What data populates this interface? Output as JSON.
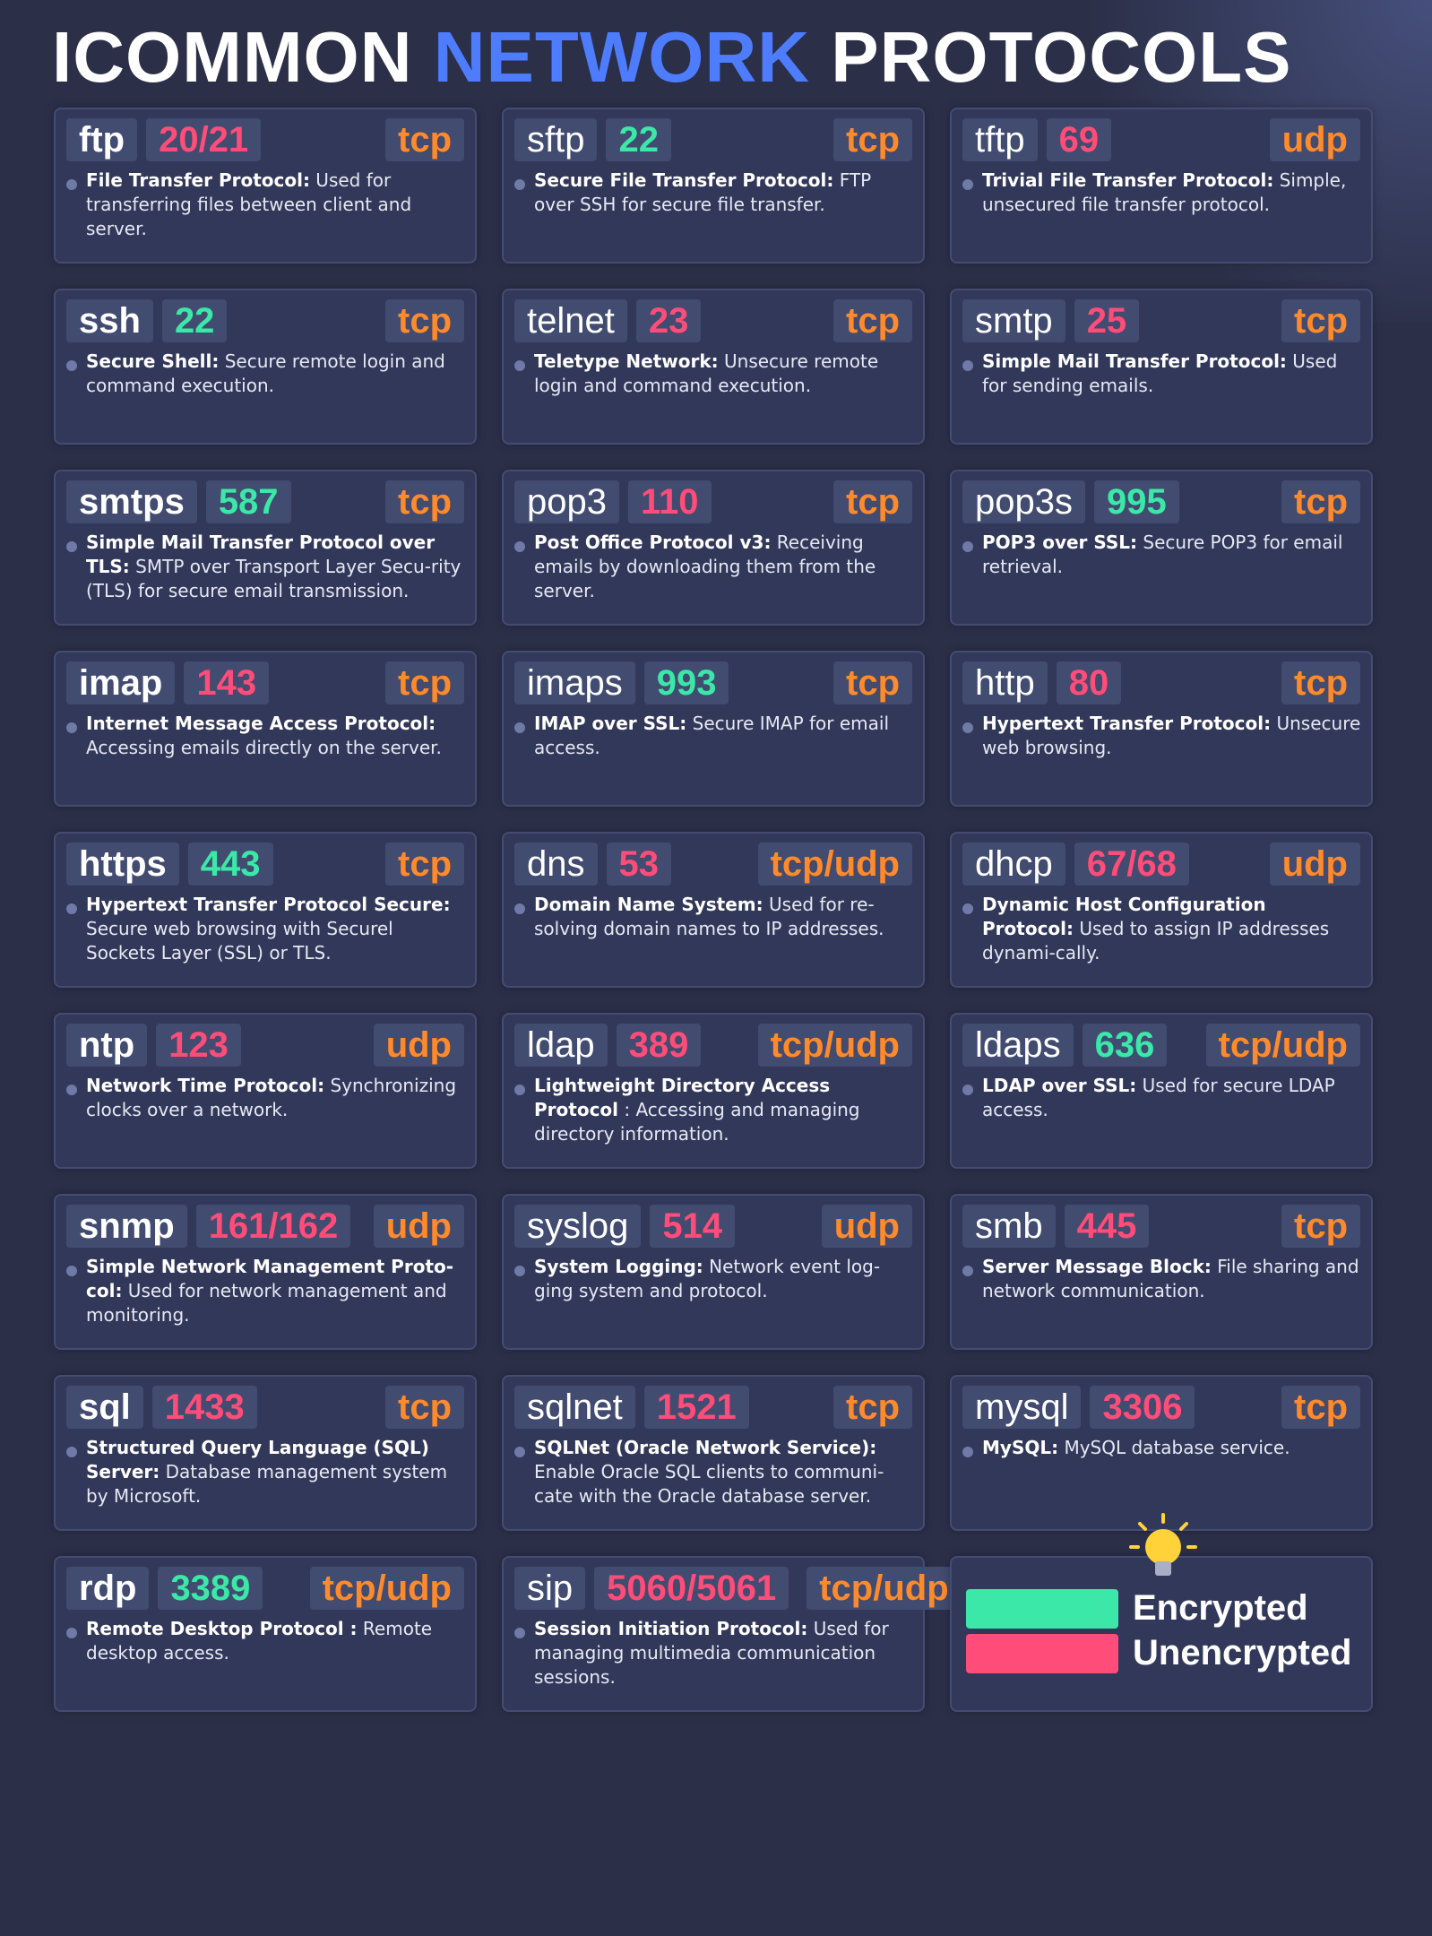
{
  "title": {
    "prefix": "ICOMMON ",
    "accent": "NETWORK",
    "suffix": " PROTOCOLS"
  },
  "colors": {
    "encrypted": "#3be8a8",
    "unencrypted": "#ff4c78",
    "transport": "#ff8a2b",
    "accent": "#4e7cff"
  },
  "protocols": [
    {
      "name": "ftp",
      "port": "20/21",
      "transport": "tcp",
      "encrypted": false,
      "term": "File Transfer Protocol:",
      "text": " Used for transferring files between client and server."
    },
    {
      "name": "sftp",
      "port": "22",
      "transport": "tcp",
      "encrypted": true,
      "term": "Secure File Transfer Protocol:",
      "text": "  FTP over SSH for secure file transfer."
    },
    {
      "name": "tftp",
      "port": "69",
      "transport": "udp",
      "encrypted": false,
      "term": "Trivial File Transfer Protocol:",
      "text": " Simple, unsecured file transfer protocol."
    },
    {
      "name": "ssh",
      "port": "22",
      "transport": "tcp",
      "encrypted": true,
      "term": "Secure Shell:",
      "text": " Secure remote login and command execution."
    },
    {
      "name": "telnet",
      "port": "23",
      "transport": "tcp",
      "encrypted": false,
      "term": "Teletype Network:",
      "text": " Unsecure remote login and command execution."
    },
    {
      "name": "smtp",
      "port": "25",
      "transport": "tcp",
      "encrypted": false,
      "term": "Simple Mail Transfer Protocol:",
      "text": "  Used for sending emails."
    },
    {
      "name": "smtps",
      "port": "587",
      "transport": "tcp",
      "encrypted": true,
      "term": "Simple Mail Transfer Protocol over TLS:",
      "text": " SMTP over Transport Layer Secu-rity (TLS) for secure email transmission."
    },
    {
      "name": "pop3",
      "port": "110",
      "transport": "tcp",
      "encrypted": false,
      "term": "Post Office Protocol v3:",
      "text": " Receiving emails by downloading them from the server."
    },
    {
      "name": "pop3s",
      "port": "995",
      "transport": "tcp",
      "encrypted": true,
      "term": "POP3 over SSL:",
      "text": " Secure POP3 for email retrieval."
    },
    {
      "name": "imap",
      "port": "143",
      "transport": "tcp",
      "encrypted": false,
      "term": "Internet Message Access Protocol:",
      "text": " Accessing emails directly on the server."
    },
    {
      "name": "imaps",
      "port": "993",
      "transport": "tcp",
      "encrypted": true,
      "term": "IMAP over SSL:",
      "text": " Secure IMAP for email access."
    },
    {
      "name": "http",
      "port": "80",
      "transport": "tcp",
      "encrypted": false,
      "term": "Hypertext Transfer Protocol:",
      "text": " Unsecure web browsing."
    },
    {
      "name": "https",
      "port": "443",
      "transport": "tcp",
      "encrypted": true,
      "term": "Hypertext Transfer Protocol Secure:",
      "text": " Secure web browsing with Securel Sockets Layer (SSL) or TLS."
    },
    {
      "name": "dns",
      "port": "53",
      "transport": "tcp/udp",
      "encrypted": false,
      "term": "Domain Name System:",
      "text": " Used for re-solving domain names to IP addresses."
    },
    {
      "name": "dhcp",
      "port": "67/68",
      "transport": "udp",
      "encrypted": false,
      "term": "Dynamic Host Configuration Protocol:",
      "text": " Used to assign IP addresses dynami-cally."
    },
    {
      "name": "ntp",
      "port": "123",
      "transport": "udp",
      "encrypted": false,
      "term": "Network Time Protocol:",
      "text": " Synchronizing clocks over a network."
    },
    {
      "name": "ldap",
      "port": "389",
      "transport": "tcp/udp",
      "encrypted": false,
      "term": "Lightweight Directory Access Protocol",
      "text": " : Accessing and managing directory information."
    },
    {
      "name": "ldaps",
      "port": "636",
      "transport": "tcp/udp",
      "encrypted": true,
      "term": "LDAP over SSL:",
      "text": " Used for secure LDAP access."
    },
    {
      "name": "snmp",
      "port": "161/162",
      "transport": "udp",
      "encrypted": false,
      "term": "Simple Network Management Proto-col:",
      "text": " Used for network management and monitoring."
    },
    {
      "name": "syslog",
      "port": "514",
      "transport": "udp",
      "encrypted": false,
      "term": "System Logging:",
      "text": " Network event log-ging system and protocol."
    },
    {
      "name": "smb",
      "port": "445",
      "transport": "tcp",
      "encrypted": false,
      "term": "Server Message Block:",
      "text": " File sharing and network communication."
    },
    {
      "name": "sql",
      "port": "1433",
      "transport": "tcp",
      "encrypted": false,
      "term": "Structured Query Language (SQL) Server:",
      "text": " Database management system by Microsoft."
    },
    {
      "name": "sqlnet",
      "port": "1521",
      "transport": "tcp",
      "encrypted": false,
      "term": "SQLNet (Oracle Network Service):",
      "text": " Enable Oracle SQL clients to communi-cate with the Oracle database server."
    },
    {
      "name": "mysql",
      "port": "3306",
      "transport": "tcp",
      "encrypted": false,
      "term": "MySQL:",
      "text": " MySQL database service."
    },
    {
      "name": "rdp",
      "port": "3389",
      "transport": "tcp/udp",
      "encrypted": true,
      "term": "Remote Desktop Protocol :",
      "text": "  Remote desktop access."
    },
    {
      "name": "sip",
      "port": "5060/5061",
      "transport": "tcp/udp",
      "encrypted": false,
      "term": "Session Initiation Protocol:",
      "text": "  Used for managing multimedia communication sessions."
    }
  ],
  "legend": {
    "icon": "lightbulb-icon",
    "encrypted_label": "Encrypted",
    "unencrypted_label": "Unencrypted"
  }
}
